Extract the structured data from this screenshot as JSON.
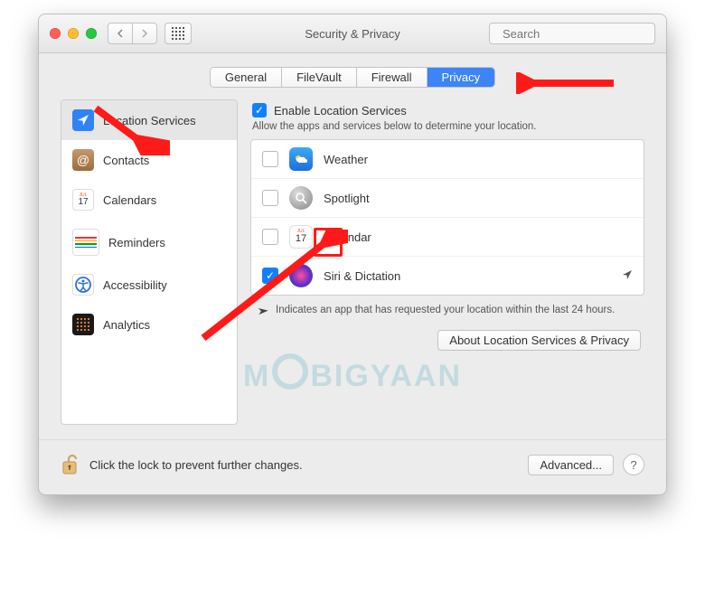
{
  "window": {
    "title": "Security & Privacy"
  },
  "search": {
    "placeholder": "Search"
  },
  "tabs": [
    {
      "label": "General",
      "active": false
    },
    {
      "label": "FileVault",
      "active": false
    },
    {
      "label": "Firewall",
      "active": false
    },
    {
      "label": "Privacy",
      "active": true
    }
  ],
  "sidebar": {
    "items": [
      {
        "label": "Location Services",
        "selected": true
      },
      {
        "label": "Contacts",
        "selected": false
      },
      {
        "label": "Calendars",
        "selected": false
      },
      {
        "label": "Reminders",
        "selected": false
      },
      {
        "label": "Accessibility",
        "selected": false
      },
      {
        "label": "Analytics",
        "selected": false
      }
    ]
  },
  "main": {
    "enable_label": "Enable Location Services",
    "enable_checked": true,
    "hint": "Allow the apps and services below to determine your location.",
    "apps": [
      {
        "label": "Weather",
        "checked": false,
        "indicator": false
      },
      {
        "label": "Spotlight",
        "checked": false,
        "indicator": false
      },
      {
        "label": "Calendar",
        "checked": false,
        "indicator": false
      },
      {
        "label": "Siri & Dictation",
        "checked": true,
        "indicator": true
      }
    ],
    "note": "Indicates an app that has requested your location within the last 24 hours.",
    "about_button": "About Location Services & Privacy"
  },
  "footer": {
    "lock_text": "Click the lock to prevent further changes.",
    "advanced_button": "Advanced...",
    "help_label": "?"
  },
  "watermark": "MOBIGYAAN"
}
